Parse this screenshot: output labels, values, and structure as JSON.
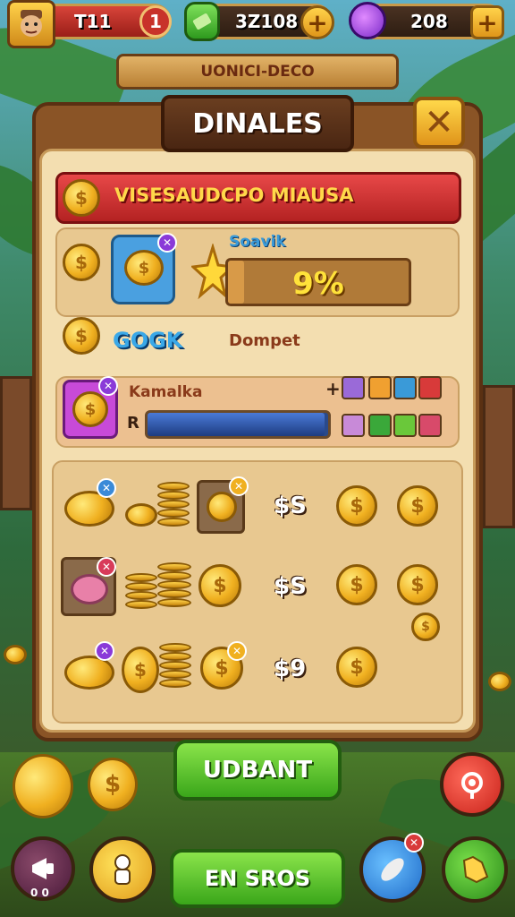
{
  "hud": {
    "player_level": "T11",
    "lives": "1",
    "cash": "3Z108",
    "gems": "208",
    "plus": "+"
  },
  "banner": {
    "text": "UONICI-DECO"
  },
  "panel": {
    "title": "DINALES",
    "close": "✕",
    "ribbon_text": "VISESAUDCPO MIAUSA",
    "progress": {
      "label": "Soavik",
      "value_text": "9%",
      "fraction": 0.09
    },
    "coin_row": {
      "amount": "GOGK",
      "label": "Dompet"
    },
    "mana": {
      "label": "Kamalka",
      "row_prefix": "R",
      "fraction": 0.98,
      "plus": "+"
    },
    "offers": [
      {
        "price": "$S"
      },
      {
        "price": "$S"
      },
      {
        "price": "$9"
      }
    ]
  },
  "buttons": {
    "main": "UDBANT",
    "bottom": "EN SROS",
    "corner_small": "0 0"
  },
  "colors": {
    "gold": "#f0b020",
    "ribbon_red": "#e84848",
    "button_green": "#3aa61a",
    "panel_cream": "#f3deb0",
    "wood": "#8a5426"
  },
  "icons": {
    "avatar": "player-avatar-icon",
    "cash": "cash-icon",
    "gem": "gem-icon",
    "star": "star-icon",
    "coin": "coin-icon"
  }
}
